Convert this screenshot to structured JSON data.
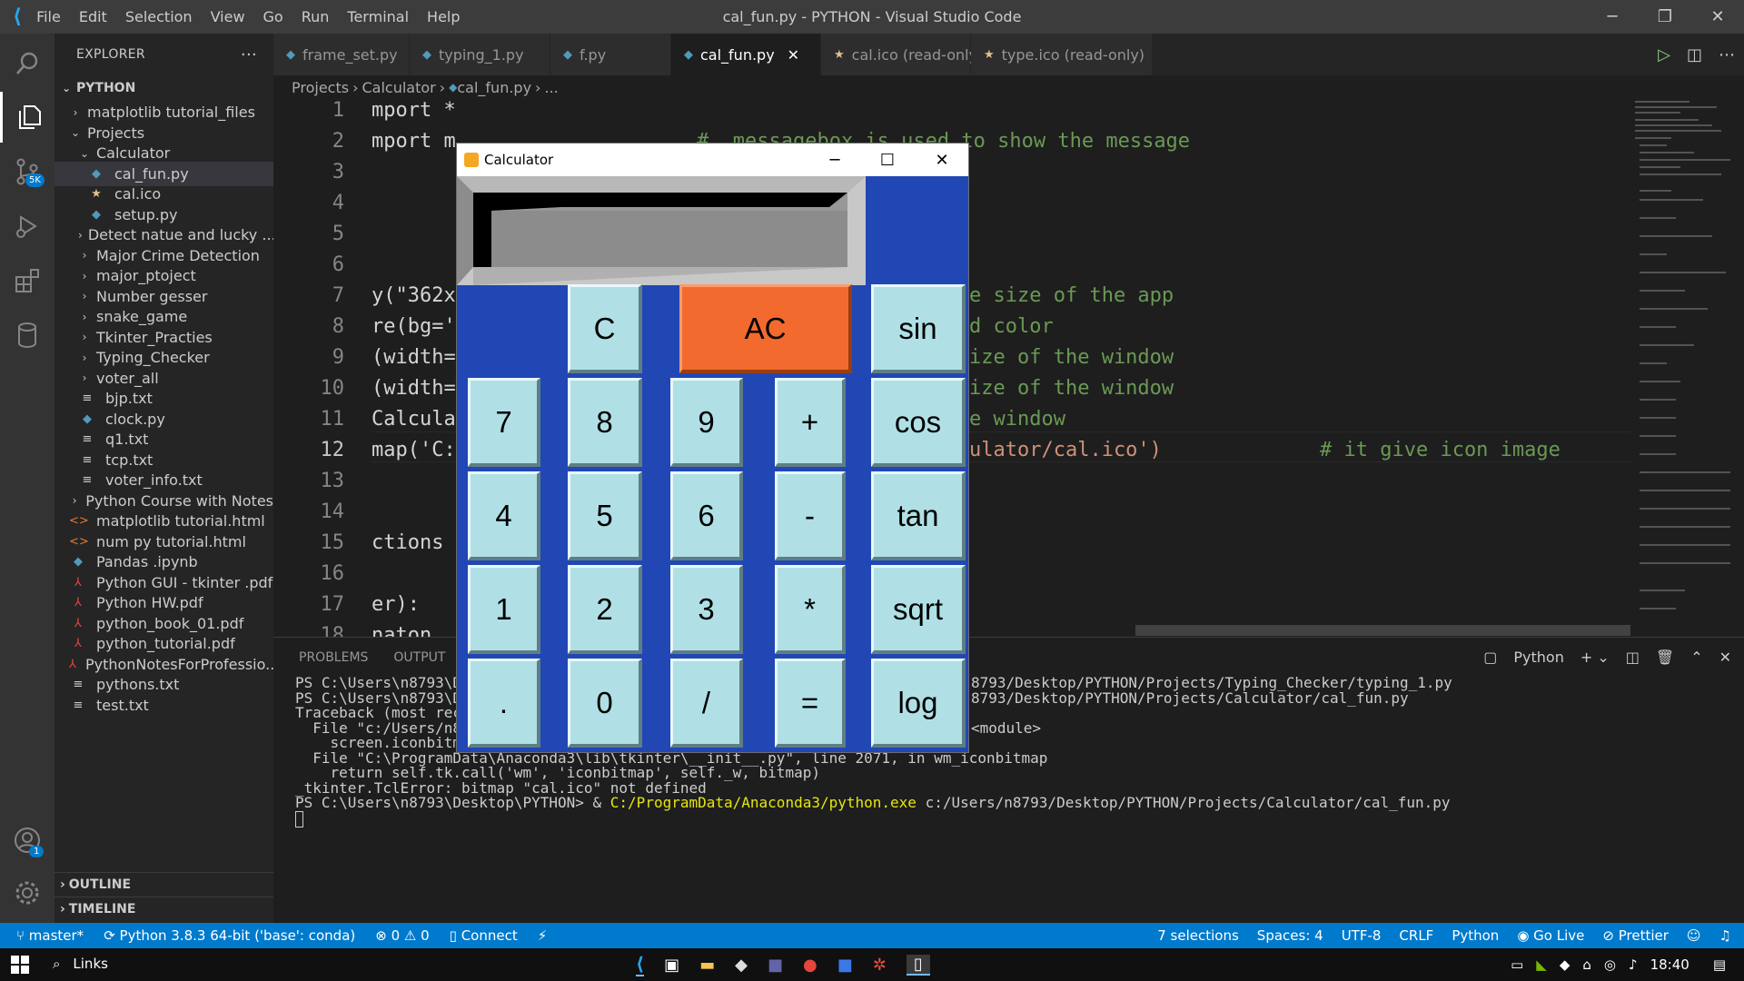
{
  "titlebar": {
    "menu": [
      "File",
      "Edit",
      "Selection",
      "View",
      "Go",
      "Run",
      "Terminal",
      "Help"
    ],
    "title": "cal_fun.py - PYTHON - Visual Studio Code"
  },
  "activity": {
    "icons": [
      "files-icon",
      "search-icon",
      "source-control-icon",
      "run-debug-icon",
      "extensions-icon",
      "database-icon"
    ],
    "scm_badge": "5K",
    "account_badge": "1"
  },
  "explorer": {
    "header": "EXPLORER",
    "more": "···",
    "root": "PYTHON",
    "items": [
      {
        "label": "matplotlib tutorial_files",
        "type": "folder",
        "open": false,
        "indent": 1
      },
      {
        "label": "Projects",
        "type": "folder",
        "open": true,
        "indent": 1
      },
      {
        "label": "Calculator",
        "type": "folder",
        "open": true,
        "indent": 2
      },
      {
        "label": "cal_fun.py",
        "type": "py",
        "indent": 3,
        "selected": true
      },
      {
        "label": "cal.ico",
        "type": "ico",
        "indent": 3
      },
      {
        "label": "setup.py",
        "type": "py",
        "indent": 3
      },
      {
        "label": "Detect natue and lucky ...",
        "type": "folder",
        "open": false,
        "indent": 2
      },
      {
        "label": "Major Crime Detection",
        "type": "folder",
        "open": false,
        "indent": 2
      },
      {
        "label": "major_ptoject",
        "type": "folder",
        "open": false,
        "indent": 2
      },
      {
        "label": "Number gesser",
        "type": "folder",
        "open": false,
        "indent": 2
      },
      {
        "label": "snake_game",
        "type": "folder",
        "open": false,
        "indent": 2
      },
      {
        "label": "Tkinter_Practies",
        "type": "folder",
        "open": false,
        "indent": 2
      },
      {
        "label": "Typing_Checker",
        "type": "folder",
        "open": false,
        "indent": 2
      },
      {
        "label": "voter_all",
        "type": "folder",
        "open": false,
        "indent": 2
      },
      {
        "label": "bjp.txt",
        "type": "txt",
        "indent": 2
      },
      {
        "label": "clock.py",
        "type": "py",
        "indent": 2
      },
      {
        "label": "q1.txt",
        "type": "txt",
        "indent": 2
      },
      {
        "label": "tcp.txt",
        "type": "txt",
        "indent": 2
      },
      {
        "label": "voter_info.txt",
        "type": "txt",
        "indent": 2
      },
      {
        "label": "Python Course with Notes",
        "type": "folder",
        "open": false,
        "indent": 1
      },
      {
        "label": "matplotlib tutorial.html",
        "type": "html",
        "indent": 1
      },
      {
        "label": "num py tutorial.html",
        "type": "html",
        "indent": 1
      },
      {
        "label": "Pandas .ipynb",
        "type": "py",
        "indent": 1
      },
      {
        "label": "Python GUI - tkinter .pdf",
        "type": "pdf",
        "indent": 1
      },
      {
        "label": "Python HW.pdf",
        "type": "pdf",
        "indent": 1
      },
      {
        "label": "python_book_01.pdf",
        "type": "pdf",
        "indent": 1
      },
      {
        "label": "python_tutorial.pdf",
        "type": "pdf",
        "indent": 1
      },
      {
        "label": "PythonNotesForProfessio...",
        "type": "pdf",
        "indent": 1
      },
      {
        "label": "pythons.txt",
        "type": "txt",
        "indent": 1
      },
      {
        "label": "test.txt",
        "type": "txt",
        "indent": 1
      }
    ],
    "outline": "OUTLINE",
    "timeline": "TIMELINE"
  },
  "tabs": [
    {
      "label": "frame_set.py",
      "icon": "py"
    },
    {
      "label": "typing_1.py",
      "icon": "py"
    },
    {
      "label": "f.py",
      "icon": "py"
    },
    {
      "label": "cal_fun.py",
      "icon": "py",
      "active": true
    },
    {
      "label": "cal.ico (read-only)",
      "icon": "ico"
    },
    {
      "label": "type.ico (read-only)",
      "icon": "ico"
    }
  ],
  "breadcrumb": [
    "Projects",
    "Calculator",
    "cal_fun.py",
    "..."
  ],
  "editor": {
    "current_line": 12,
    "lines": [
      {
        "n": "1",
        "text": "mport *"
      },
      {
        "n": "2",
        "text": "mport m",
        "comment": "#  messagebox is used to show the message"
      },
      {
        "n": "3",
        "text": ""
      },
      {
        "n": "4",
        "text": ""
      },
      {
        "n": "5",
        "text": ""
      },
      {
        "n": "6",
        "text": ""
      },
      {
        "n": "7",
        "text": "y(\"362x",
        "tail": "e size of the app"
      },
      {
        "n": "8",
        "text": "re(bg='",
        "tail": "d color"
      },
      {
        "n": "9",
        "text": "(width=",
        "tail": "ize of the window"
      },
      {
        "n": "10",
        "text": "(width=",
        "tail": "ize of the window"
      },
      {
        "n": "11",
        "text": "Calcula",
        "tail": "e window"
      },
      {
        "n": "12",
        "text": "map('C:",
        "tail": "ulator/cal.ico')",
        "comment": "# it give icon image"
      },
      {
        "n": "13",
        "text": ""
      },
      {
        "n": "14",
        "text": ""
      },
      {
        "n": "15",
        "text": "ctions"
      },
      {
        "n": "16",
        "text": ""
      },
      {
        "n": "17",
        "text": "er):"
      },
      {
        "n": "18",
        "text": "naton"
      }
    ]
  },
  "panel": {
    "tabs": [
      "PROBLEMS",
      "OUTPUT"
    ],
    "terminal_label": "Python",
    "lines": [
      {
        "left": "PS C:\\Users\\n8793\\De",
        "right": "8793/Desktop/PYTHON/Projects/Typing_Checker/typing_1.py"
      },
      {
        "left": "PS C:\\Users\\n8793\\De",
        "right": "8793/Desktop/PYTHON/Projects/Calculator/cal_fun.py"
      },
      {
        "left": "Traceback (most rece",
        "right": ""
      },
      {
        "left": "  File \"c:/Users/n8",
        "right": "<module>"
      },
      {
        "left": "    screen.iconbitmap('cal.ico')           # it give icon image",
        "right": ""
      },
      {
        "left": "  File \"C:\\ProgramData\\Anaconda3\\lib\\tkinter\\__init__.py\", line 2071, in wm_iconbitmap",
        "right": ""
      },
      {
        "left": "    return self.tk.call('wm', 'iconbitmap', self._w, bitmap)",
        "right": ""
      },
      {
        "left": "_tkinter.TclError: bitmap \"cal.ico\" not defined",
        "right": ""
      }
    ],
    "prompt": "PS C:\\Users\\n8793\\Desktop\\PYTHON> & ",
    "exe": "C:/ProgramData/Anaconda3/python.exe",
    "script": " c:/Users/n8793/Desktop/PYTHON/Projects/Calculator/cal_fun.py"
  },
  "statusbar": {
    "left": [
      "master*",
      "Python 3.8.3 64-bit ('base': conda)",
      "⊗ 0 ⚠ 0",
      "Connect"
    ],
    "right": [
      "7 selections",
      "Spaces: 4",
      "UTF-8",
      "CRLF",
      "Python",
      "Go Live",
      "Prettier"
    ]
  },
  "taskbar": {
    "search": "Links",
    "time": "18:40"
  },
  "calculator": {
    "title": "Calculator",
    "buttons": [
      {
        "label": "C",
        "row": 0,
        "col": 1
      },
      {
        "label": "AC",
        "row": 0,
        "col": 2,
        "wide": true
      },
      {
        "label": "sin",
        "row": 0,
        "col": 4
      },
      {
        "label": "7",
        "row": 1,
        "col": 0
      },
      {
        "label": "8",
        "row": 1,
        "col": 1
      },
      {
        "label": "9",
        "row": 1,
        "col": 2
      },
      {
        "label": "+",
        "row": 1,
        "col": 3
      },
      {
        "label": "cos",
        "row": 1,
        "col": 4
      },
      {
        "label": "4",
        "row": 2,
        "col": 0
      },
      {
        "label": "5",
        "row": 2,
        "col": 1
      },
      {
        "label": "6",
        "row": 2,
        "col": 2
      },
      {
        "label": "-",
        "row": 2,
        "col": 3
      },
      {
        "label": "tan",
        "row": 2,
        "col": 4
      },
      {
        "label": "1",
        "row": 3,
        "col": 0
      },
      {
        "label": "2",
        "row": 3,
        "col": 1
      },
      {
        "label": "3",
        "row": 3,
        "col": 2
      },
      {
        "label": "*",
        "row": 3,
        "col": 3
      },
      {
        "label": "sqrt",
        "row": 3,
        "col": 4
      },
      {
        "label": ".",
        "row": 4,
        "col": 0
      },
      {
        "label": "0",
        "row": 4,
        "col": 1
      },
      {
        "label": "/",
        "row": 4,
        "col": 2
      },
      {
        "label": "=",
        "row": 4,
        "col": 3
      },
      {
        "label": "log",
        "row": 4,
        "col": 4
      }
    ]
  },
  "colors": {
    "calc_bg": "#2147b5",
    "calc_button": "#b0e0e6",
    "calc_ac": "#f26a2e",
    "status": "#007acc"
  }
}
